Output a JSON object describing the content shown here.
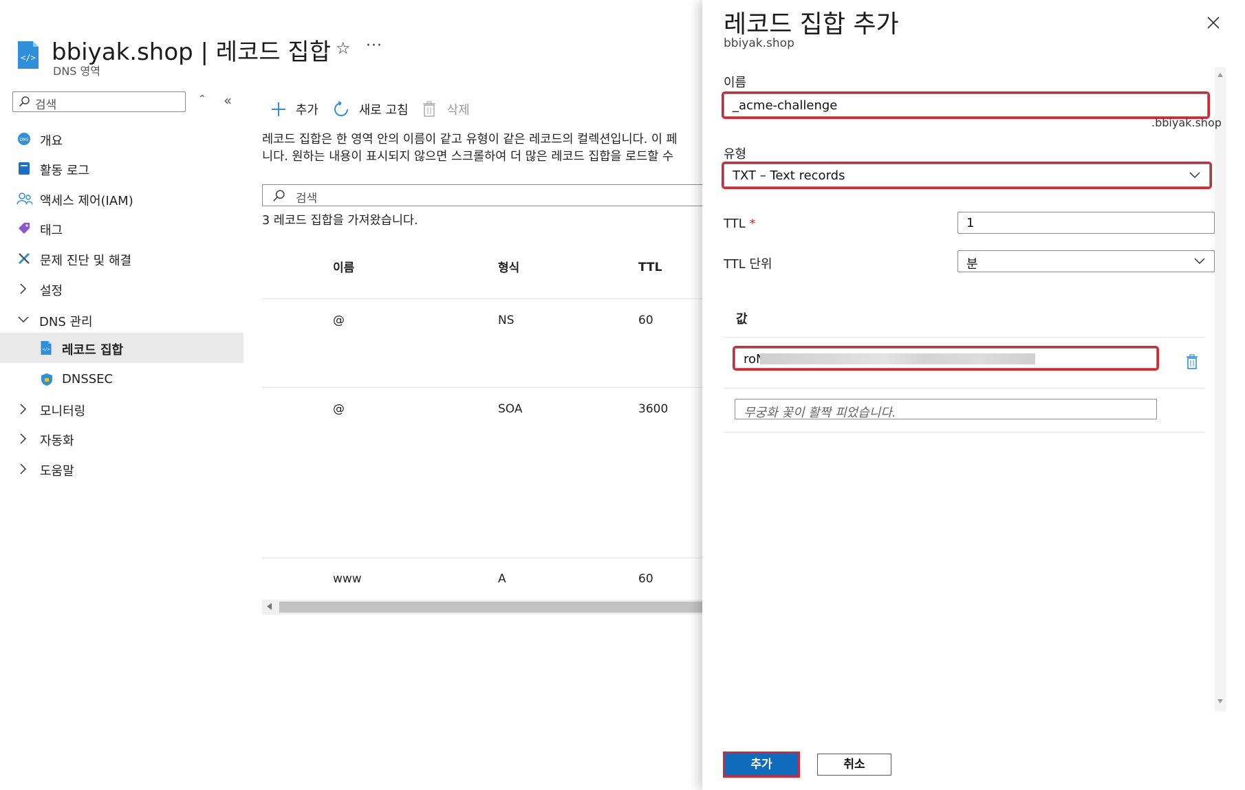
{
  "header": {
    "title": "bbiyak.shop | 레코드 집합",
    "subtitle": "DNS 영역",
    "favorite_icon": "star-icon",
    "more_label": "···"
  },
  "sidebar": {
    "search_placeholder": "검색",
    "items": [
      {
        "label": "개요",
        "icon": "dns-icon"
      },
      {
        "label": "활동 로그",
        "icon": "log-icon"
      },
      {
        "label": "액세스 제어(IAM)",
        "icon": "people-icon"
      },
      {
        "label": "태그",
        "icon": "tag-icon"
      },
      {
        "label": "문제 진단 및 해결",
        "icon": "wrench-icon"
      },
      {
        "label": "설정",
        "icon": "chevron-right-icon"
      },
      {
        "label": "DNS 관리",
        "icon": "chevron-down-icon"
      },
      {
        "label": "레코드 집합",
        "icon": "record-set-icon",
        "selected": true
      },
      {
        "label": "DNSSEC",
        "icon": "shield-icon"
      },
      {
        "label": "모니터링",
        "icon": "chevron-right-icon"
      },
      {
        "label": "자동화",
        "icon": "chevron-right-icon"
      },
      {
        "label": "도움말",
        "icon": "chevron-right-icon"
      }
    ]
  },
  "toolbar": {
    "add_label": "추가",
    "refresh_label": "새로 고침",
    "delete_label": "삭제"
  },
  "main": {
    "description_line1": "레코드 집합은 한 영역 안의 이름이 같고 유형이 같은 레코드의 컬렉션입니다. 이 페",
    "description_line2": "니다. 원하는 내용이 표시되지 않으면 스크롤하여 더 많은 레코드 집합을 로드할 수",
    "search_placeholder": "검색",
    "count_text": "3 레코드 집합을 가져왔습니다.",
    "columns": [
      "이름",
      "형식",
      "TTL"
    ],
    "rows": [
      {
        "name": "@",
        "type": "NS",
        "ttl": "60"
      },
      {
        "name": "@",
        "type": "SOA",
        "ttl": "3600"
      },
      {
        "name": "www",
        "type": "A",
        "ttl": "60"
      }
    ]
  },
  "panel": {
    "title": "레코드 집합 추가",
    "subtitle": "bbiyak.shop",
    "name_label": "이름",
    "name_value": "_acme-challenge",
    "name_suffix": ".bbiyak.shop",
    "type_label": "유형",
    "type_value": "TXT – Text records",
    "ttl_label": "TTL",
    "ttl_required": "*",
    "ttl_value": "1",
    "ttl_unit_label": "TTL 단위",
    "ttl_unit_value": "분",
    "value_header": "값",
    "value_entry": "roN",
    "value_placeholder": "무궁화 꽃이 활짝 피었습니다.",
    "add_button": "추가",
    "cancel_button": "취소"
  },
  "colors": {
    "accent": "#0f6cbd",
    "highlight": "#d8252f",
    "selected_bg": "#e9e9e9"
  }
}
